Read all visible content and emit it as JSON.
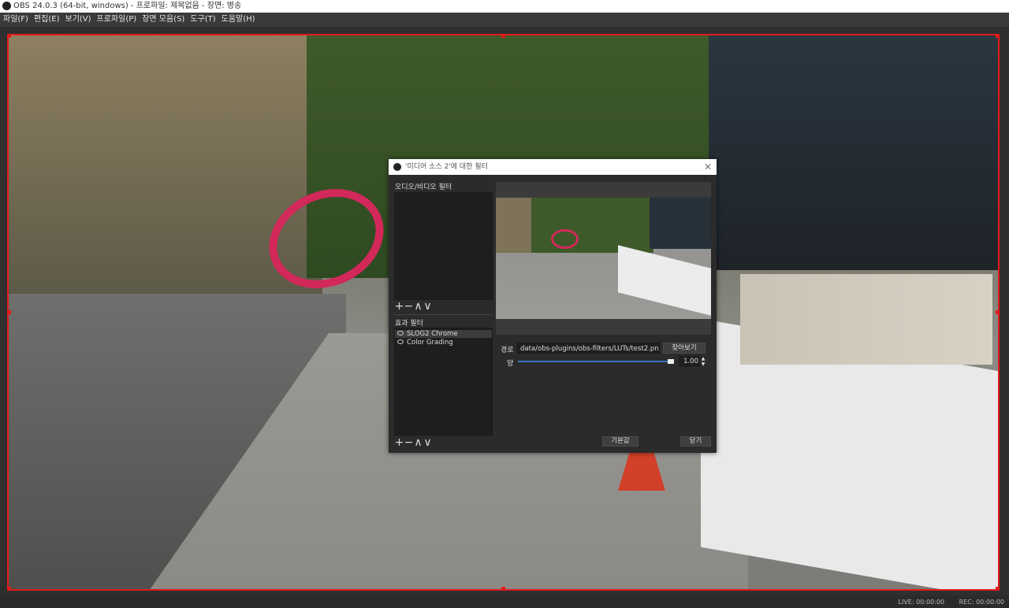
{
  "window": {
    "title": "OBS 24.0.3 (64-bit, windows) - 프로파일: 제목없음 - 장면: 병송",
    "icon": "obs-logo-icon"
  },
  "menu": [
    {
      "label": "파일(F)"
    },
    {
      "label": "편집(E)"
    },
    {
      "label": "보기(V)"
    },
    {
      "label": "프로파일(P)"
    },
    {
      "label": "장면 모음(S)"
    },
    {
      "label": "도구(T)"
    },
    {
      "label": "도움말(H)"
    }
  ],
  "dialog": {
    "title": "'미디어 소스 2'에 대한 필터",
    "close_icon": "close-icon",
    "audio_video_label": "오디오/비디오 필터",
    "effect_label": "효과 필터",
    "toolbar": {
      "add": "+",
      "remove": "−",
      "up": "∧",
      "down": "∨"
    },
    "effect_filters": [
      {
        "name": "SLOG2 Chrome",
        "icon": "eye-icon",
        "selected": true
      },
      {
        "name": "Color Grading",
        "icon": "eye-icon",
        "selected": false
      }
    ],
    "path_label": "경로",
    "path_value": "data/obs-plugins/obs-filters/LUTs/test2.png",
    "browse_label": "찾아보기",
    "amount_label": "양",
    "amount_value": "1.00",
    "amount_fraction": 1.0,
    "defaults_label": "기본값",
    "close_label": "닫기"
  },
  "statusbar": {
    "live": "LIVE: 00:00:00",
    "rec": "REC: 00:00:00"
  },
  "colors": {
    "selection_border": "#e31a1a",
    "slider_accent": "#3877c5",
    "background": "#2b2b2b"
  }
}
